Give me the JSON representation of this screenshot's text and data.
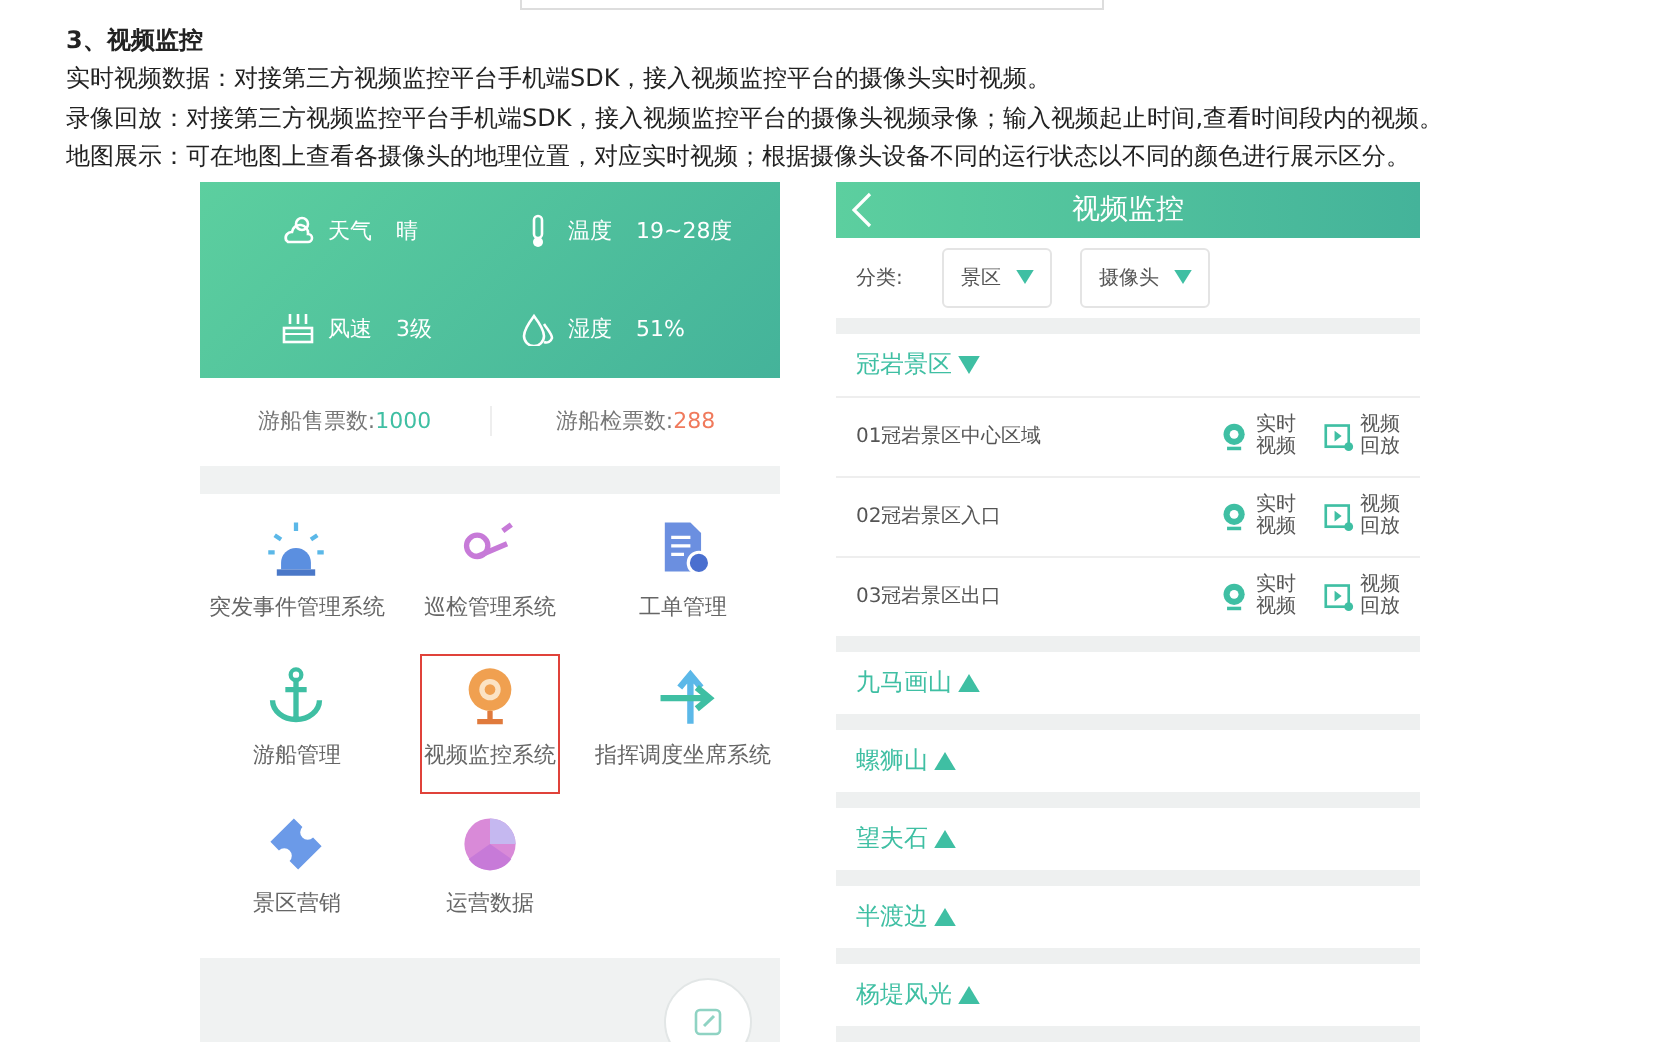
{
  "doc": {
    "heading": "3、视频监控",
    "paragraphs": [
      "实时视频数据：对接第三方视频监控平台手机端SDK，接入视频监控平台的摄像头实时视频。",
      "录像回放：对接第三方视频监控平台手机端SDK，接入视频监控平台的摄像头视频录像；输入视频起止时间,查看时间段内的视频。",
      "地图展示：可在地图上查看各摄像头的地理位置，对应实时视频；根据摄像头设备不同的运行状态以不同的颜色进行展示区分。"
    ]
  },
  "left_phone": {
    "weather": [
      {
        "kind": "weather",
        "label": "天气",
        "value": "晴"
      },
      {
        "kind": "temperature",
        "label": "温度",
        "value": "19~28度"
      },
      {
        "kind": "wind",
        "label": "风速",
        "value": "3级"
      },
      {
        "kind": "humidity",
        "label": "湿度",
        "value": "51%"
      }
    ],
    "tickets": [
      {
        "label": "游船售票数:",
        "value": "1000",
        "color": "#3fbfa3"
      },
      {
        "label": "游船检票数:",
        "value": "288",
        "color": "#f07a5c"
      }
    ],
    "apps": [
      {
        "kind": "alarm",
        "label": "突发事件管理系统",
        "selected": false
      },
      {
        "kind": "patrol",
        "label": "巡检管理系统",
        "selected": false
      },
      {
        "kind": "workorder",
        "label": "工单管理",
        "selected": false
      },
      {
        "kind": "boat",
        "label": "游船管理",
        "selected": false
      },
      {
        "kind": "camera",
        "label": "视频监控系统",
        "selected": true
      },
      {
        "kind": "dispatch",
        "label": "指挥调度坐席系统",
        "selected": false
      },
      {
        "kind": "ticket",
        "label": "景区营销",
        "selected": false
      },
      {
        "kind": "chart",
        "label": "运营数据",
        "selected": false
      }
    ]
  },
  "right_phone": {
    "title": "视频监控",
    "filter_label": "分类:",
    "filters": [
      "景区",
      "摄像头"
    ],
    "groups": [
      {
        "name": "冠岩景区",
        "expanded": true,
        "cameras": [
          {
            "name": "01冠岩景区中心区域",
            "actions": [
              {
                "kind": "live",
                "label": "实时视频"
              },
              {
                "kind": "playback",
                "label": "视频回放"
              }
            ]
          },
          {
            "name": "02冠岩景区入口",
            "actions": [
              {
                "kind": "live",
                "label": "实时视频"
              },
              {
                "kind": "playback",
                "label": "视频回放"
              }
            ]
          },
          {
            "name": "03冠岩景区出口",
            "actions": [
              {
                "kind": "live",
                "label": "实时视频"
              },
              {
                "kind": "playback",
                "label": "视频回放"
              }
            ]
          }
        ]
      },
      {
        "name": "九马画山",
        "expanded": false
      },
      {
        "name": "螺狮山",
        "expanded": false
      },
      {
        "name": "望夫石",
        "expanded": false
      },
      {
        "name": "半渡边",
        "expanded": false
      },
      {
        "name": "杨堤风光",
        "expanded": false
      }
    ]
  }
}
